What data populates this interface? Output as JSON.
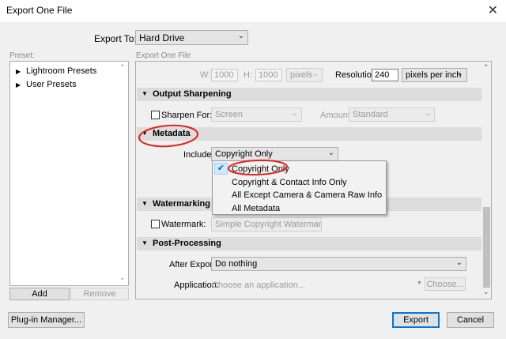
{
  "window": {
    "title": "Export One File",
    "close_glyph": "✕"
  },
  "export_to": {
    "label": "Export To:",
    "value": "Hard Drive"
  },
  "preset": {
    "header": "Preset:",
    "items": [
      "Lightroom Presets",
      "User Presets"
    ],
    "add_label": "Add",
    "remove_label": "Remove"
  },
  "main_header": "Export One File",
  "image_sizing": {
    "w_label": "W:",
    "w_value": "1000",
    "h_label": "H:",
    "h_value": "1000",
    "units": "pixels",
    "resolution_label": "Resolution:",
    "resolution_value": "240",
    "resolution_units": "pixels per inch"
  },
  "output_sharpening": {
    "title": "Output Sharpening",
    "sharpen_for_label": "Sharpen For:",
    "sharpen_for_value": "Screen",
    "amount_label": "Amount:",
    "amount_value": "Standard"
  },
  "metadata": {
    "title": "Metadata",
    "include_label": "Include:",
    "include_value": "Copyright Only",
    "options": [
      "Copyright Only",
      "Copyright & Contact Info Only",
      "All Except Camera & Camera Raw Info",
      "All Metadata"
    ]
  },
  "watermarking": {
    "title": "Watermarking",
    "watermark_label": "Watermark:",
    "watermark_value": "Simple Copyright Watermark"
  },
  "post_processing": {
    "title": "Post-Processing",
    "after_export_label": "After Export:",
    "after_export_value": "Do nothing",
    "application_label": "Application:",
    "application_placeholder": "Choose an application...",
    "choose_label": "Choose..."
  },
  "footer": {
    "plugin_manager_label": "Plug-in Manager...",
    "export_label": "Export",
    "cancel_label": "Cancel"
  },
  "colors": {
    "annotation": "#e0201c",
    "accent": "#0078d7"
  }
}
